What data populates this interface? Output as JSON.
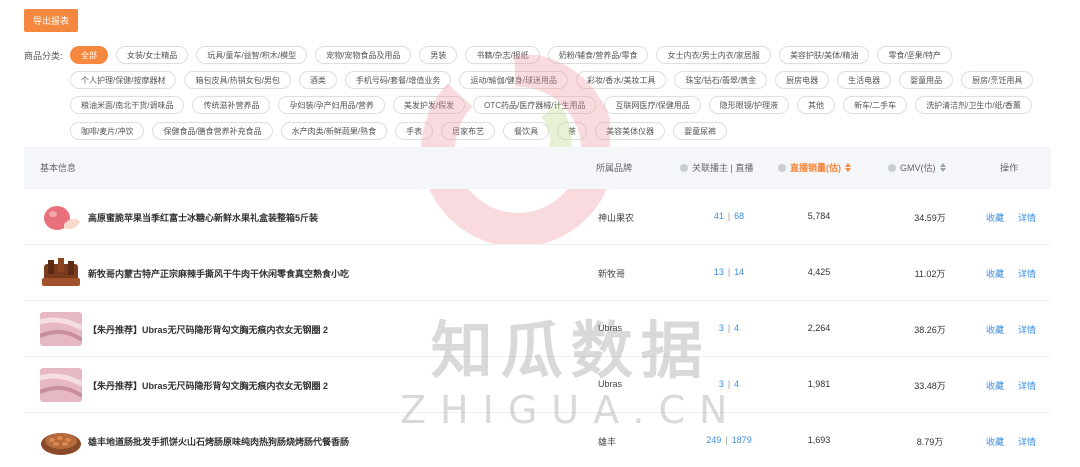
{
  "toolbar": {
    "export_label": "导出报表"
  },
  "categories": {
    "label": "商品分类:",
    "rows": [
      [
        "全部",
        "女装/女士精品",
        "玩具/童车/益智/积木/模型",
        "宠物/宠物食品及用品",
        "男装",
        "书籍/杂志/报纸",
        "奶粉/辅食/营养品/零食",
        "女士内衣/男士内衣/家居服",
        "美容护肤/美体/精油",
        "零食/坚果/特产"
      ],
      [
        "个人护理/保健/按摩器材",
        "箱包皮具/热销女包/男包",
        "酒类",
        "手机号码/套餐/增值业务",
        "运动/瑜伽/健身/球迷用品",
        "彩妆/香水/美妆工具",
        "珠宝/钻石/翡翠/黄金",
        "厨房电器",
        "生活电器",
        "婴童用品",
        "厨房/烹饪用具"
      ],
      [
        "粮油米面/南北干货/调味品",
        "传统滋补营养品",
        "孕妇装/孕产妇用品/营养",
        "美发护发/假发",
        "OTC药品/医疗器械/计生用品",
        "互联网医疗/保健用品",
        "隐形眼镜/护理液",
        "其他",
        "新车/二手车",
        "洗护清洁剂/卫生巾/纸/香薰"
      ],
      [
        "咖啡/麦片/冲饮",
        "保健食品/膳食营养补充食品",
        "水产肉类/新鲜蔬果/熟食",
        "手表",
        "居家布艺",
        "餐饮具",
        "茶",
        "美容美体仪器",
        "婴童尿裤"
      ]
    ],
    "active": "全部"
  },
  "table": {
    "headers": {
      "info": "基本信息",
      "brand": "所属品牌",
      "anchor": "关联播主 | 直播",
      "sales": "直播销量(估)",
      "gmv": "GMV(估)",
      "op": "操作"
    },
    "rows": [
      {
        "title": "高原蜜脆苹果当季红富士冰糖心新鲜水果礼盒装整箱5斤装",
        "brand": "神山果农",
        "anchors": "41",
        "lives": "68",
        "sales": "5,784",
        "gmv": "34.59万",
        "collect": "收藏",
        "detail": "详情",
        "thumb": "apple"
      },
      {
        "title": "新牧哥内蒙古特产正宗麻辣手撕风干牛肉干休闲零食真空熟食小吃",
        "brand": "新牧哥",
        "anchors": "13",
        "lives": "14",
        "sales": "4,425",
        "gmv": "11.02万",
        "collect": "收藏",
        "detail": "详情",
        "thumb": "beef"
      },
      {
        "title": "【朱丹推荐】Ubras无尺码隐形背勾文胸无痕内衣女无钢圈 2",
        "brand": "Ubras",
        "anchors": "3",
        "lives": "4",
        "sales": "2,264",
        "gmv": "38.26万",
        "collect": "收藏",
        "detail": "详情",
        "thumb": "fabric"
      },
      {
        "title": "【朱丹推荐】Ubras无尺码隐形背勾文胸无痕内衣女无钢圈 2",
        "brand": "Ubras",
        "anchors": "3",
        "lives": "4",
        "sales": "1,981",
        "gmv": "33.48万",
        "collect": "收藏",
        "detail": "详情",
        "thumb": "fabric"
      },
      {
        "title": "雄丰地道肠批发手抓饼火山石烤肠原味纯肉热狗肠烧烤肠代餐香肠",
        "brand": "雄丰",
        "anchors": "249",
        "lives": "1879",
        "sales": "1,693",
        "gmv": "8.79万",
        "collect": "收藏",
        "detail": "详情",
        "thumb": "sausage"
      }
    ]
  },
  "watermark": {
    "cn": "知瓜数据",
    "en": "ZHIGUA.CN"
  },
  "colors": {
    "accent": "#f5873e",
    "link": "#3d8fe0",
    "header_bg": "#f4f6f9"
  }
}
